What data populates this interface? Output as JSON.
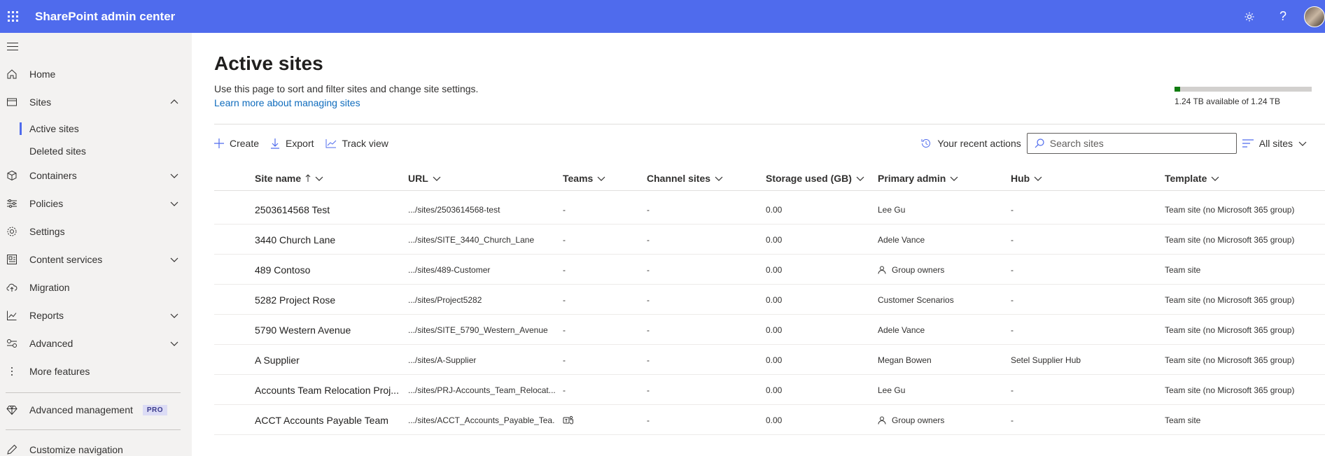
{
  "app": {
    "title": "SharePoint admin center"
  },
  "sidebar": {
    "items": [
      {
        "label": "Home",
        "icon": "home-icon"
      },
      {
        "label": "Sites",
        "icon": "sites-icon",
        "expanded": true
      },
      {
        "label": "Containers",
        "icon": "containers-icon"
      },
      {
        "label": "Policies",
        "icon": "policies-icon"
      },
      {
        "label": "Settings",
        "icon": "gear-icon"
      },
      {
        "label": "Content services",
        "icon": "content-services-icon"
      },
      {
        "label": "Migration",
        "icon": "cloud-upload-icon"
      },
      {
        "label": "Reports",
        "icon": "chart-icon"
      },
      {
        "label": "Advanced",
        "icon": "advanced-icon"
      },
      {
        "label": "More features",
        "icon": "more-icon"
      },
      {
        "label": "Advanced management",
        "icon": "diamond-icon",
        "badge": "PRO"
      },
      {
        "label": "Customize navigation",
        "icon": "pencil-icon"
      }
    ],
    "sub_items": [
      "Active sites",
      "Deleted sites"
    ]
  },
  "page": {
    "title": "Active sites",
    "description": "Use this page to sort and filter sites and change site settings.",
    "learn_more": "Learn more about managing sites"
  },
  "storage": {
    "text": "1.24 TB available of 1.24 TB",
    "used_fraction": 0.04,
    "color": "#107c10"
  },
  "toolbar": {
    "create": "Create",
    "export": "Export",
    "track_view": "Track view",
    "recent_actions": "Your recent actions",
    "search_placeholder": "Search sites",
    "view_filter": "All sites"
  },
  "table": {
    "headers": [
      "Site name",
      "URL",
      "Teams",
      "Channel sites",
      "Storage used (GB)",
      "Primary admin",
      "Hub",
      "Template"
    ],
    "rows": [
      {
        "name": "2503614568 Test",
        "url": ".../sites/2503614568-test",
        "teams": "-",
        "channel": "-",
        "storage": "0.00",
        "admin": "Lee Gu",
        "admin_group": false,
        "hub": "-",
        "template": "Team site (no Microsoft 365 group)"
      },
      {
        "name": "3440 Church Lane",
        "url": ".../sites/SITE_3440_Church_Lane",
        "teams": "-",
        "channel": "-",
        "storage": "0.00",
        "admin": "Adele Vance",
        "admin_group": false,
        "hub": "-",
        "template": "Team site (no Microsoft 365 group)"
      },
      {
        "name": "489 Contoso",
        "url": ".../sites/489-Customer",
        "teams": "-",
        "channel": "-",
        "storage": "0.00",
        "admin": "Group owners",
        "admin_group": true,
        "hub": "-",
        "template": "Team site"
      },
      {
        "name": "5282 Project Rose",
        "url": ".../sites/Project5282",
        "teams": "-",
        "channel": "-",
        "storage": "0.00",
        "admin": "Customer Scenarios",
        "admin_group": false,
        "hub": "-",
        "template": "Team site (no Microsoft 365 group)"
      },
      {
        "name": "5790 Western Avenue",
        "url": ".../sites/SITE_5790_Western_Avenue",
        "teams": "-",
        "channel": "-",
        "storage": "0.00",
        "admin": "Adele Vance",
        "admin_group": false,
        "hub": "-",
        "template": "Team site (no Microsoft 365 group)"
      },
      {
        "name": "A Supplier",
        "url": ".../sites/A-Supplier",
        "teams": "-",
        "channel": "-",
        "storage": "0.00",
        "admin": "Megan Bowen",
        "admin_group": false,
        "hub": "Setel Supplier Hub",
        "template": "Team site (no Microsoft 365 group)"
      },
      {
        "name": "Accounts Team Relocation Proj...",
        "url": ".../sites/PRJ-Accounts_Team_Relocat...",
        "teams": "-",
        "channel": "-",
        "storage": "0.00",
        "admin": "Lee Gu",
        "admin_group": false,
        "hub": "-",
        "template": "Team site (no Microsoft 365 group)"
      },
      {
        "name": "ACCT Accounts Payable Team",
        "url": ".../sites/ACCT_Accounts_Payable_Tea...",
        "teams": "teams-icon",
        "channel": "-",
        "storage": "0.00",
        "admin": "Group owners",
        "admin_group": true,
        "hub": "-",
        "template": "Team site"
      }
    ]
  },
  "colors": {
    "accent": "#4f6bed",
    "link": "#0f6cbd"
  }
}
